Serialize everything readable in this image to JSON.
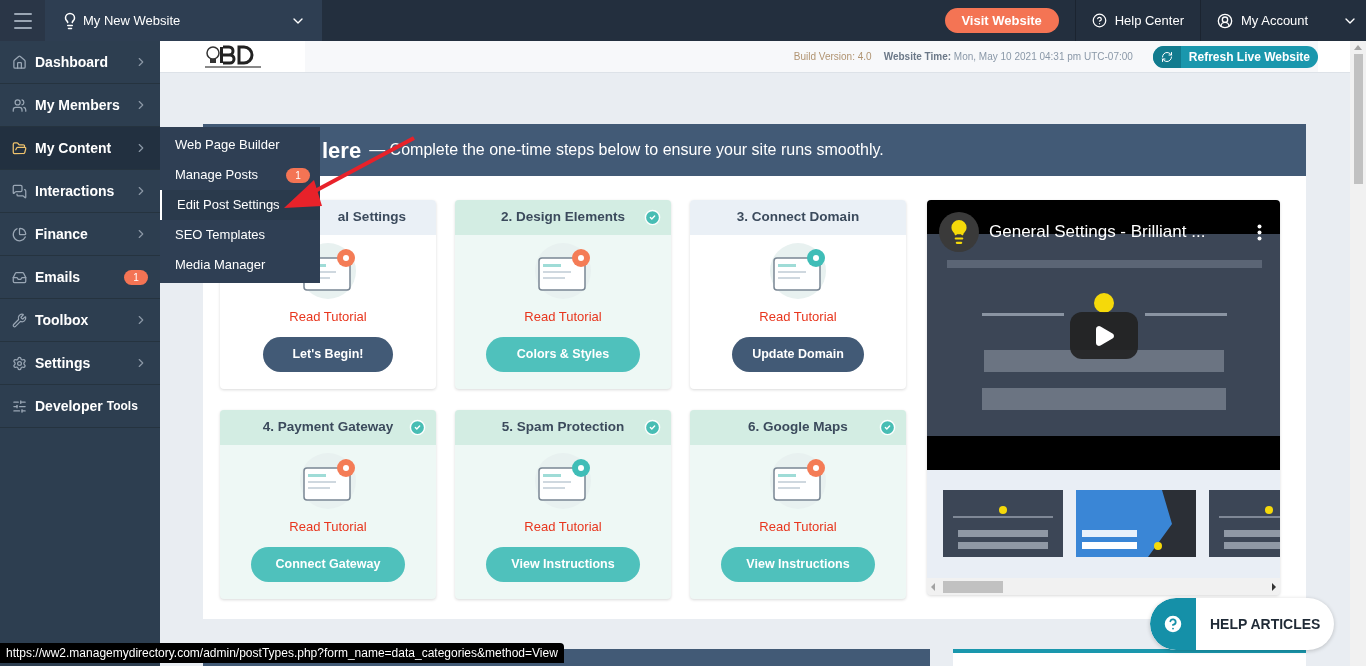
{
  "topbar": {
    "site_name": "My New Website",
    "visit_button": "Visit Website",
    "help": "Help Center",
    "account": "My Account"
  },
  "sidebar": {
    "items": [
      {
        "label": "Dashboard",
        "selected": false,
        "has_arrow": true
      },
      {
        "label": "My Members",
        "selected": false,
        "has_arrow": true
      },
      {
        "label": "My Content",
        "selected": true,
        "has_arrow": true
      },
      {
        "label": "Interactions",
        "selected": false,
        "has_arrow": true
      },
      {
        "label": "Finance",
        "selected": false,
        "has_arrow": true
      },
      {
        "label": "Emails",
        "selected": false,
        "has_arrow": false,
        "badge": "1"
      },
      {
        "label": "Toolbox",
        "selected": false,
        "has_arrow": true
      },
      {
        "label": "Settings",
        "selected": false,
        "has_arrow": true
      },
      {
        "label": "Developer",
        "suffix": "Tools",
        "selected": false,
        "has_arrow": false
      }
    ]
  },
  "submenu": {
    "items": [
      {
        "label": "Web Page Builder",
        "selected": false
      },
      {
        "label": "Manage Posts",
        "selected": false,
        "badge": "1"
      },
      {
        "label": "Edit Post Settings",
        "selected": true
      },
      {
        "label": "SEO Templates",
        "selected": false
      },
      {
        "label": "Media Manager",
        "selected": false
      }
    ]
  },
  "infobar": {
    "build": "Build Version: 4.0",
    "time_label": "Website Time:",
    "time_value": "Mon, May 10 2021 04:31 pm UTC-07:00",
    "refresh_button": "Refresh Live Website"
  },
  "banner": {
    "heading": "lere",
    "text": "— Complete the one-time steps below to ensure your site runs smoothly."
  },
  "cards": [
    {
      "title": "al Settings",
      "done": false,
      "link": "Read Tutorial",
      "button": "Let's Begin!",
      "kind": "dark"
    },
    {
      "title": "2. Design Elements",
      "done": true,
      "link": "Read Tutorial",
      "button": "Colors & Styles",
      "kind": "teal"
    },
    {
      "title": "3. Connect Domain",
      "done": false,
      "link": "Read Tutorial",
      "button": "Update Domain",
      "kind": "dark"
    },
    {
      "title": "4. Payment Gateway",
      "done": true,
      "link": "Read Tutorial",
      "button": "Connect Gateway",
      "kind": "teal"
    },
    {
      "title": "5. Spam Protection",
      "done": true,
      "link": "Read Tutorial",
      "button": "View Instructions",
      "kind": "teal"
    },
    {
      "title": "6. Google Maps",
      "done": true,
      "link": "Read Tutorial",
      "button": "View Instructions",
      "kind": "teal"
    }
  ],
  "video": {
    "title": "General Settings - Brilliant ..."
  },
  "help_button": "HELP ARTICLES",
  "status_url": "https://ww2.managemydirectory.com/admin/postTypes.php?form_name=data_categories&method=View"
}
